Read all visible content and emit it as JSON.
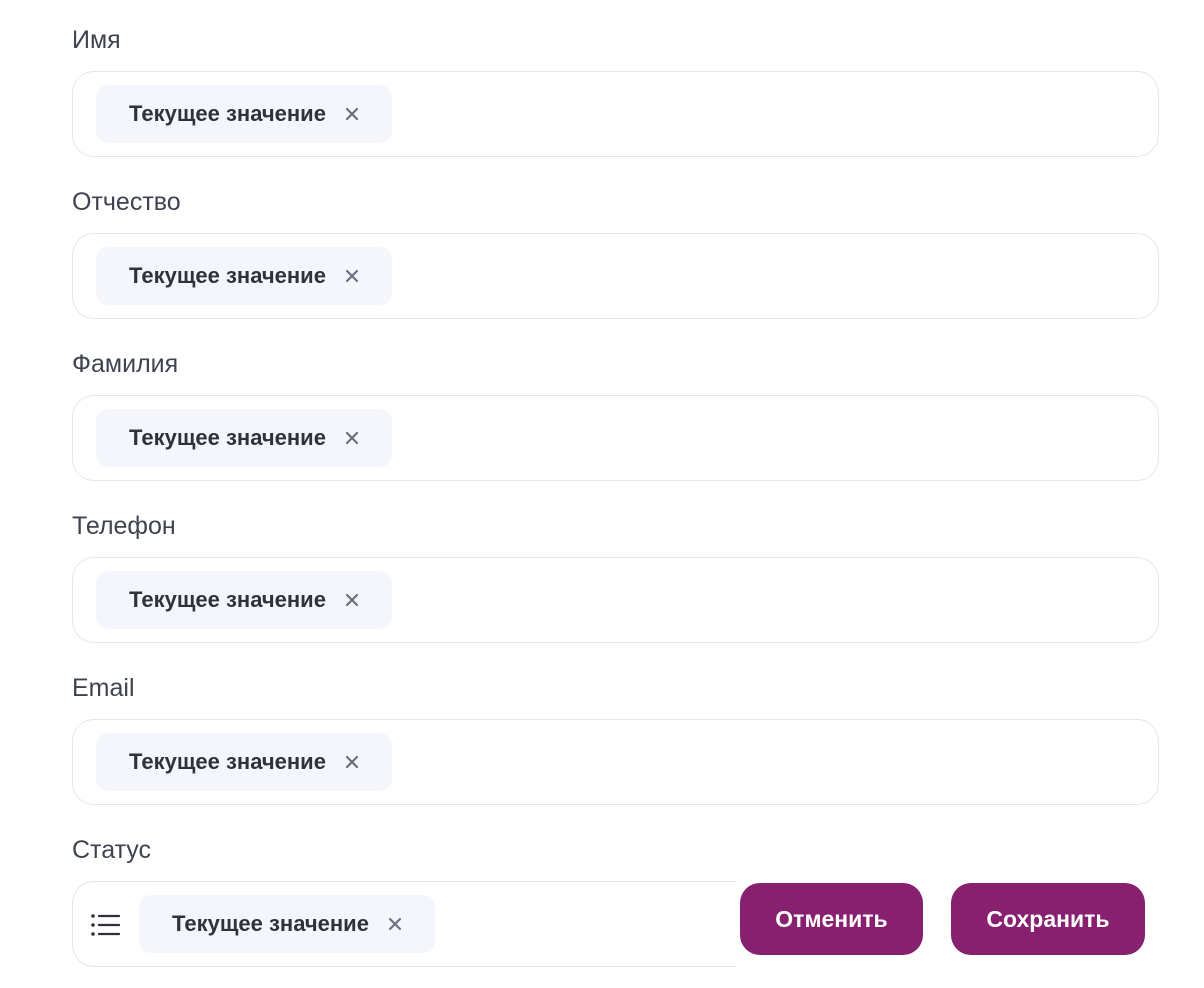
{
  "fields": [
    {
      "label": "Имя",
      "value": "Текущее значение"
    },
    {
      "label": "Отчество",
      "value": "Текущее значение"
    },
    {
      "label": "Фамилия",
      "value": "Текущее значение"
    },
    {
      "label": "Телефон",
      "value": "Текущее значение"
    },
    {
      "label": "Email",
      "value": "Текущее значение"
    }
  ],
  "status": {
    "label": "Статус",
    "value": "Текущее значение",
    "icon": "list-icon"
  },
  "actions": {
    "cancel_label": "Отменить",
    "save_label": "Сохранить"
  },
  "colors": {
    "accent": "#86206f",
    "chip_bg": "#f5f6fb",
    "border": "#e4e6ec"
  }
}
